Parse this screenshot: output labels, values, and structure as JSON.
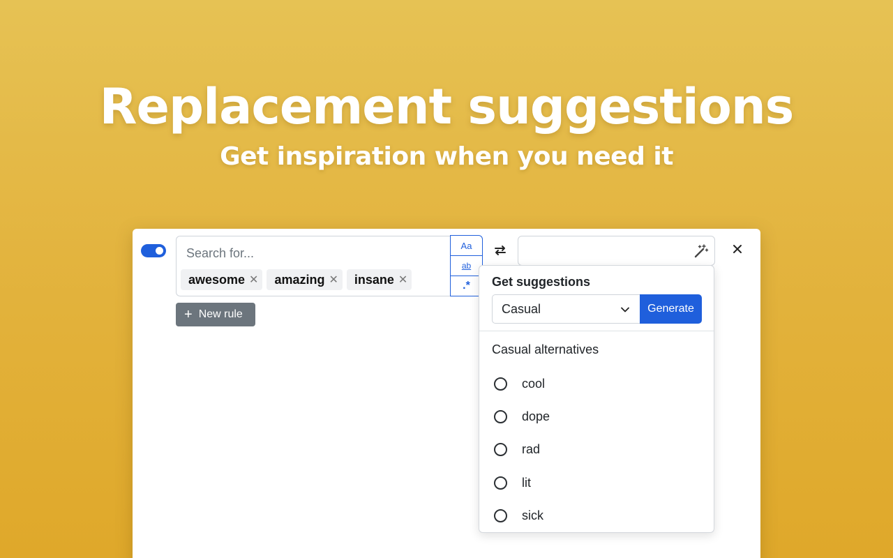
{
  "hero": {
    "title": "Replacement suggestions",
    "subtitle": "Get inspiration when you need it"
  },
  "rule": {
    "enabled": true,
    "search_placeholder": "Search for...",
    "tags": [
      {
        "label": "awesome"
      },
      {
        "label": "amazing"
      },
      {
        "label": "insane"
      }
    ],
    "options": {
      "match_case": "Aa",
      "whole_word": "ab",
      "regex": ".*"
    },
    "replace_value": ""
  },
  "new_rule_label": "New rule",
  "suggestions": {
    "title": "Get suggestions",
    "tone": "Casual",
    "generate_label": "Generate",
    "alternatives_heading": "Casual alternatives",
    "alternatives": [
      "cool",
      "dope",
      "rad",
      "lit",
      "sick"
    ]
  },
  "colors": {
    "accent": "#1f5fdc",
    "background_top": "#e6c254",
    "background_bottom": "#dfa82a",
    "secondary_button": "#6c757d"
  },
  "icons": {
    "swap": "swap-arrows-icon",
    "wand": "magic-wand-icon",
    "close": "close-icon",
    "chevron": "chevron-down-icon",
    "plus": "plus-icon"
  }
}
